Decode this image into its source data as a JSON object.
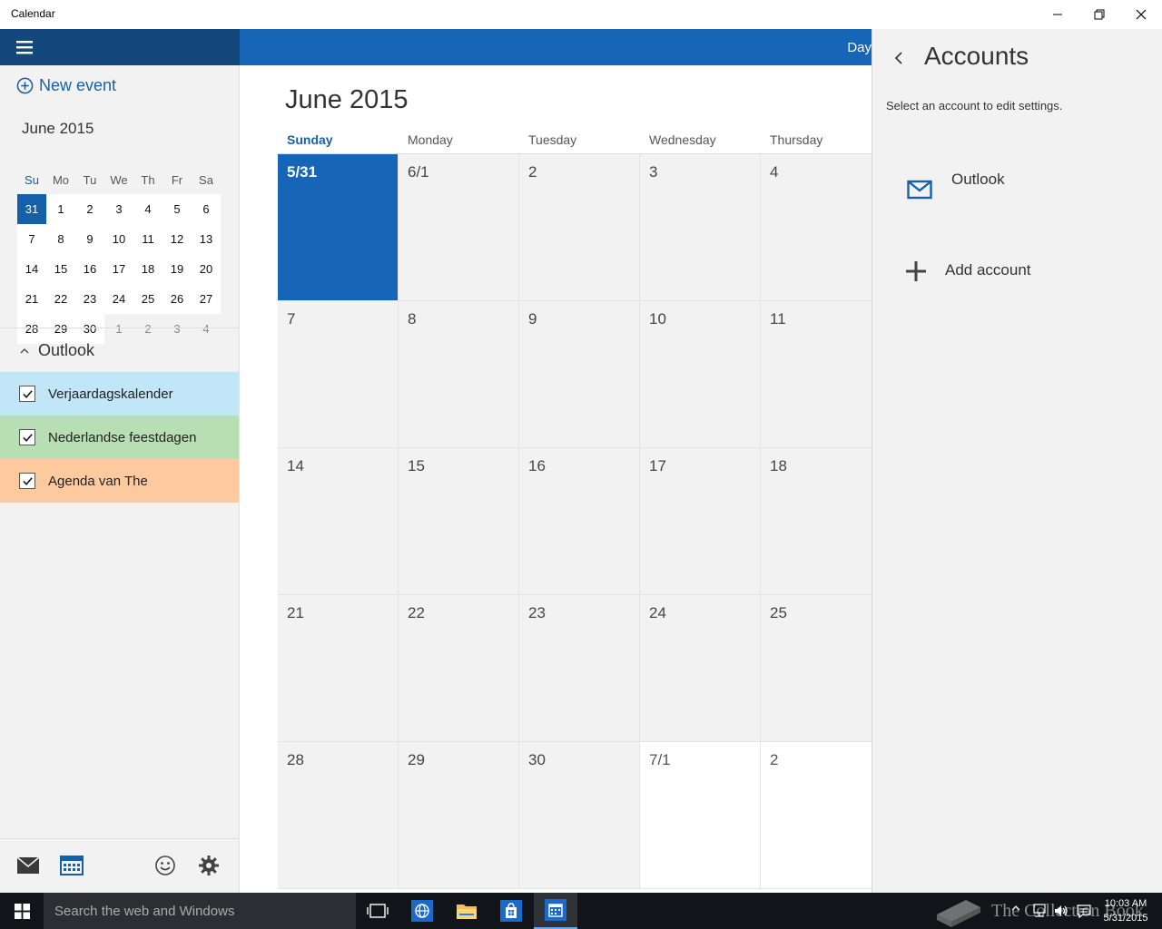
{
  "window": {
    "title": "Calendar"
  },
  "left_pane": {
    "new_event_label": "New event",
    "mini_calendar": {
      "title": "June 2015",
      "weekdays": [
        "Su",
        "Mo",
        "Tu",
        "We",
        "Th",
        "Fr",
        "Sa"
      ],
      "weeks": [
        [
          "31",
          "1",
          "2",
          "3",
          "4",
          "5",
          "6"
        ],
        [
          "7",
          "8",
          "9",
          "10",
          "11",
          "12",
          "13"
        ],
        [
          "14",
          "15",
          "16",
          "17",
          "18",
          "19",
          "20"
        ],
        [
          "21",
          "22",
          "23",
          "24",
          "25",
          "26",
          "27"
        ],
        [
          "28",
          "29",
          "30",
          "1",
          "2",
          "3",
          "4"
        ]
      ],
      "selected": "31"
    },
    "account_group": "Outlook",
    "calendars": [
      {
        "label": "Verjaardagskalender",
        "checked": true,
        "color": "#c0e6f8"
      },
      {
        "label": "Nederlandse feestdagen",
        "checked": true,
        "color": "#b7dfb3"
      },
      {
        "label": "Agenda van The",
        "checked": true,
        "color": "#fdcaa0"
      }
    ],
    "bottom_icons": [
      "mail-icon",
      "calendar-icon",
      "feedback-smiley-icon",
      "settings-gear-icon"
    ]
  },
  "main": {
    "view_button": "Day",
    "month_title": "June 2015",
    "weekday_headers": [
      "Sunday",
      "Monday",
      "Tuesday",
      "Wednesday",
      "Thursday"
    ],
    "weeks": [
      [
        "5/31",
        "6/1",
        "2",
        "3",
        "4"
      ],
      [
        "7",
        "8",
        "9",
        "10",
        "11"
      ],
      [
        "14",
        "15",
        "16",
        "17",
        "18"
      ],
      [
        "21",
        "22",
        "23",
        "24",
        "25"
      ],
      [
        "28",
        "29",
        "30",
        "7/1",
        "2"
      ]
    ]
  },
  "accounts_panel": {
    "title": "Accounts",
    "subtitle": "Select an account to edit settings.",
    "accounts": [
      {
        "label": "Outlook",
        "icon": "mail-envelope-icon"
      }
    ],
    "add_account_label": "Add account"
  },
  "taskbar": {
    "search_placeholder": "Search the web and Windows",
    "apps": [
      "task-view-icon",
      "edge-browser-icon",
      "file-explorer-icon",
      "store-icon",
      "calendar-app-icon"
    ],
    "watermark_text": "The Collection Book",
    "clock_time": "10:03 AM",
    "clock_date": "5/31/2015"
  },
  "colors": {
    "accent": "#1765b6",
    "accent_dark": "#14487c",
    "pane_bg": "#f2f2f2"
  }
}
